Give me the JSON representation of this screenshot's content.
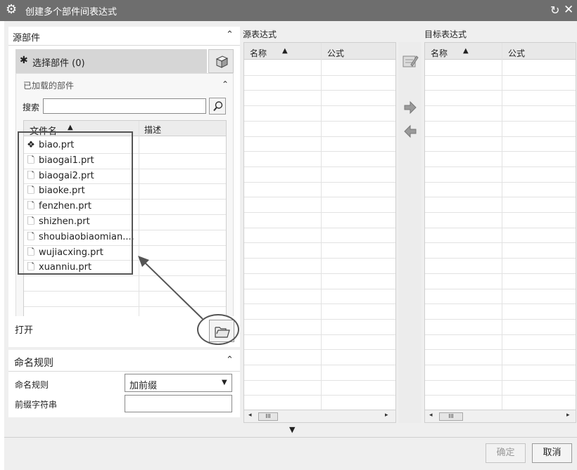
{
  "window": {
    "title": "创建多个部件间表达式"
  },
  "source_parts": {
    "section_title": "源部件",
    "select_label": "选择部件 (0)",
    "loaded_title": "已加载的部件",
    "search_label": "搜索",
    "search_value": "",
    "col_filename": "文件名",
    "col_desc": "描述",
    "files": [
      {
        "name": "biao.prt",
        "icon": "part-active-icon"
      },
      {
        "name": "biaogai1.prt",
        "icon": "part-file-icon"
      },
      {
        "name": "biaogai2.prt",
        "icon": "part-file-icon"
      },
      {
        "name": "biaoke.prt",
        "icon": "part-file-icon"
      },
      {
        "name": "fenzhen.prt",
        "icon": "part-file-icon"
      },
      {
        "name": "shizhen.prt",
        "icon": "part-file-icon"
      },
      {
        "name": "shoubiaobiaomian....",
        "icon": "part-file-icon"
      },
      {
        "name": "wujiacxing.prt",
        "icon": "part-file-icon"
      },
      {
        "name": "xuanniu.prt",
        "icon": "part-file-icon"
      }
    ],
    "open_label": "打开"
  },
  "naming": {
    "section_title": "命名规则",
    "rule_label": "命名规则",
    "rule_value": "加前缀",
    "prefix_label": "前缀字符串",
    "prefix_value": ""
  },
  "source_expr": {
    "title": "源表达式",
    "col_name": "名称",
    "col_formula": "公式"
  },
  "target_expr": {
    "title": "目标表达式",
    "col_name": "名称",
    "col_formula": "公式"
  },
  "scroll_mark": "III",
  "buttons": {
    "ok": "确定",
    "cancel": "取消"
  },
  "colors": {
    "titlebar": "#6e6e6e",
    "annotation": "#555555"
  }
}
